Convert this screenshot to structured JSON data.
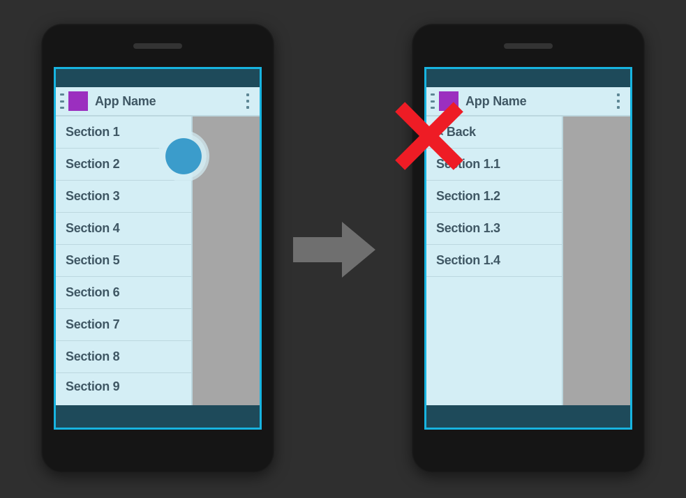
{
  "colors": {
    "accent": "#17b4e0",
    "statusBar": "#1e4a5a",
    "drawerBg": "#d4eef5",
    "appIcon": "#9b2fbf",
    "text": "#3f5764",
    "touchDot": "#3b9ccb",
    "errorX": "#ee1c25"
  },
  "leftPhone": {
    "appTitle": "App Name",
    "drawerItems": [
      "Section 1",
      "Section 2",
      "Section 3",
      "Section 4",
      "Section 5",
      "Section 6",
      "Section 7",
      "Section 8",
      "Section 9"
    ]
  },
  "rightPhone": {
    "appTitle": "App Name",
    "drawerItems": [
      "< Back",
      "Section 1.1",
      "Section 1.2",
      "Section 1.3",
      "Section 1.4"
    ]
  }
}
